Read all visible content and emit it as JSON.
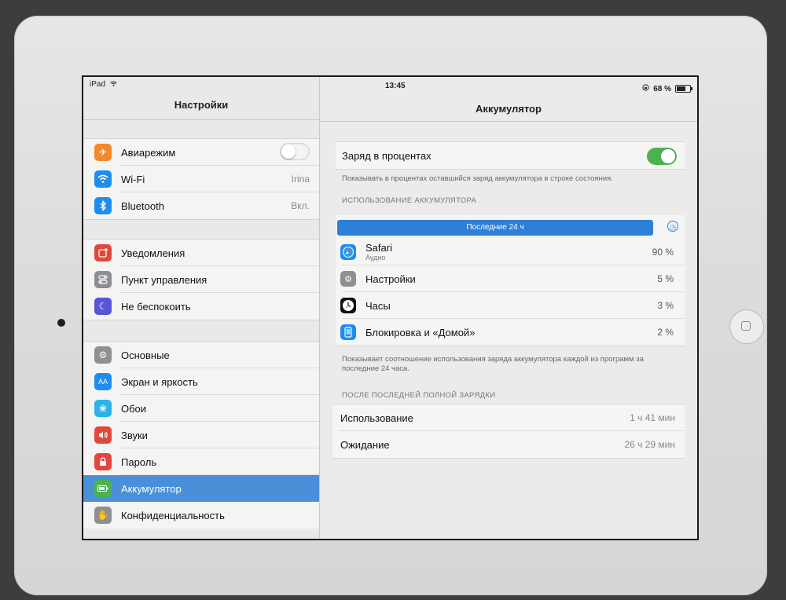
{
  "status": {
    "device": "iPad",
    "time": "13:45",
    "battery_percent": "68 %",
    "battery_level": 0.68
  },
  "sidebar": {
    "title": "Настройки",
    "groups": [
      {
        "items": [
          {
            "label": "Авиарежим",
            "icon": "airplane-icon",
            "color": "#f18a2a",
            "toggle": false
          },
          {
            "label": "Wi-Fi",
            "icon": "wifi-icon",
            "color": "#1d8df0",
            "value": "Irina"
          },
          {
            "label": "Bluetooth",
            "icon": "bluetooth-icon",
            "color": "#1d8df0",
            "value": "Вкл."
          }
        ]
      },
      {
        "items": [
          {
            "label": "Уведомления",
            "icon": "notifications-icon",
            "color": "#e3463c"
          },
          {
            "label": "Пункт управления",
            "icon": "control-center-icon",
            "color": "#8e8e93"
          },
          {
            "label": "Не беспокоить",
            "icon": "moon-icon",
            "color": "#5856d6"
          }
        ]
      },
      {
        "items": [
          {
            "label": "Основные",
            "icon": "gear-icon",
            "color": "#8e8e93"
          },
          {
            "label": "Экран и яркость",
            "icon": "display-icon",
            "color": "#1d8df0"
          },
          {
            "label": "Обои",
            "icon": "wallpaper-icon",
            "color": "#2ab3e8"
          },
          {
            "label": "Звуки",
            "icon": "sound-icon",
            "color": "#e3463c"
          },
          {
            "label": "Пароль",
            "icon": "lock-icon",
            "color": "#e3463c"
          },
          {
            "label": "Аккумулятор",
            "icon": "battery-icon",
            "color": "#4cb151",
            "selected": true
          },
          {
            "label": "Конфиденциальность",
            "icon": "hand-icon",
            "color": "#8e8e93"
          }
        ]
      }
    ]
  },
  "detail": {
    "title": "Аккумулятор",
    "percent_toggle": {
      "label": "Заряд в процентах",
      "on": true
    },
    "percent_note": "Показывать в процентах оставшийся заряд аккумулятора в строке состояния.",
    "usage_header": "ИСПОЛЬЗОВАНИЕ АККУМУЛЯТОРА",
    "segment_label": "Последние 24 ч",
    "apps": [
      {
        "name": "Safari",
        "sub": "Аудио",
        "percent": "90 %",
        "icon": "safari-icon",
        "color": "#1d8df0"
      },
      {
        "name": "Настройки",
        "percent": "5 %",
        "icon": "settings-app-icon",
        "color": "#8e8e93"
      },
      {
        "name": "Часы",
        "percent": "3 %",
        "icon": "clock-app-icon",
        "color": "#111111"
      },
      {
        "name": "Блокировка и «Домой»",
        "percent": "2 %",
        "icon": "lock-home-icon",
        "color": "#1d8df0"
      }
    ],
    "apps_note": "Показывает соотношение использования заряда аккумулятора каждой из программ за последние 24 часа.",
    "since_header": "ПОСЛЕ ПОСЛЕДНЕЙ ПОЛНОЙ ЗАРЯДКИ",
    "usage": [
      {
        "label": "Использование",
        "value": "1 ч 41 мин"
      },
      {
        "label": "Ожидание",
        "value": "26 ч 29 мин"
      }
    ]
  }
}
